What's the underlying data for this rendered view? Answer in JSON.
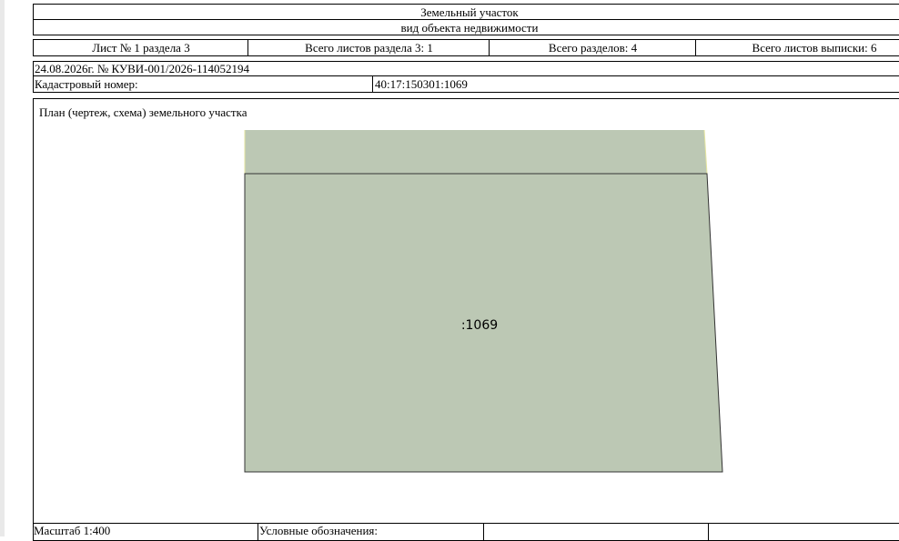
{
  "header": {
    "title": "Земельный участок",
    "subtitle": "вид объекта недвижимости"
  },
  "sheet_info": {
    "sheet": "Лист № 1 раздела 3",
    "total_sheets_section": "Всего листов раздела 3: 1",
    "total_sections": "Всего разделов: 4",
    "total_sheets_extract": "Всего листов выписки: 6"
  },
  "extract": {
    "date_number": "24.08.2026г. № КУВИ-001/2026-114052194",
    "cadastral_label": "Кадастровый номер:",
    "cadastral_value": "40:17:150301:1069"
  },
  "plan": {
    "heading": "План (чертеж, схема) земельного участка",
    "parcel_label": ":1069",
    "fill_color": "#bcc8b4",
    "edge_color": "#e6e6a0"
  },
  "footer": {
    "scale": "Масштаб 1:400",
    "legend": "Условные обозначения:"
  }
}
